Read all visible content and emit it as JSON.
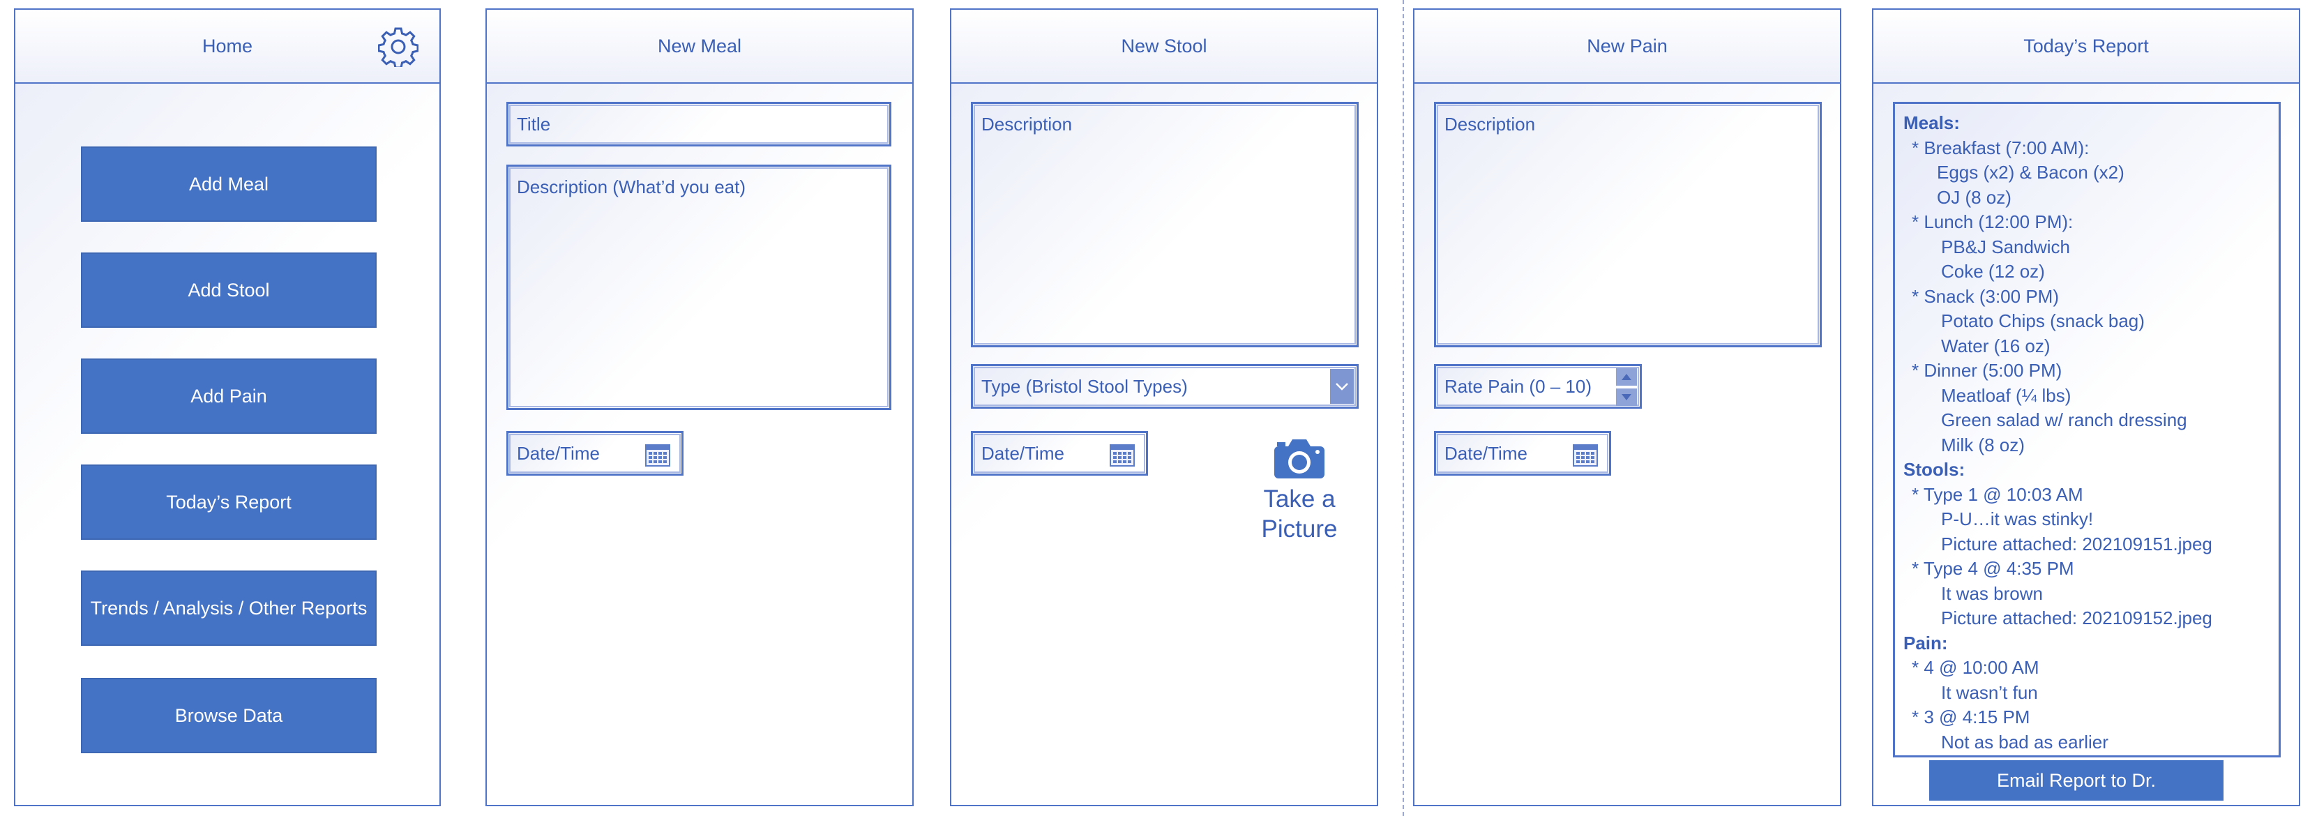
{
  "colors": {
    "accent": "#4472c4",
    "border": "#4f74c8",
    "text": "#3a5fb5"
  },
  "home": {
    "title": "Home",
    "settings_icon": "gear-icon",
    "buttons": [
      "Add Meal",
      "Add Stool",
      "Add Pain",
      "Today’s Report",
      "Trends / Analysis / Other Reports",
      "Browse Data"
    ]
  },
  "new_meal": {
    "title": "New Meal",
    "title_field": "Title",
    "description_field": "Description (What’d you eat)",
    "datetime_field": "Date/Time"
  },
  "new_stool": {
    "title": "New Stool",
    "description_field": "Description",
    "type_dropdown": "Type (Bristol Stool Types)",
    "datetime_field": "Date/Time",
    "picture_label_1": "Take a",
    "picture_label_2": "Picture"
  },
  "new_pain": {
    "title": "New Pain",
    "description_field": "Description",
    "rate_field": "Rate Pain (0 – 10)",
    "datetime_field": "Date/Time"
  },
  "report": {
    "title": "Today’s Report",
    "lines": [
      {
        "text": "Meals:",
        "style": "h"
      },
      {
        "text": "* Breakfast (7:00 AM):",
        "style": "i1"
      },
      {
        "text": "Eggs (x2) & Bacon (x2)",
        "style": "i2b"
      },
      {
        "text": "OJ (8 oz)",
        "style": "i2b"
      },
      {
        "text": "* Lunch (12:00 PM):",
        "style": "i1"
      },
      {
        "text": "PB&J Sandwich",
        "style": "i2"
      },
      {
        "text": "Coke (12 oz)",
        "style": "i2"
      },
      {
        "text": "* Snack (3:00 PM)",
        "style": "i1"
      },
      {
        "text": "Potato Chips (snack bag)",
        "style": "i2"
      },
      {
        "text": "Water (16 oz)",
        "style": "i2"
      },
      {
        "text": "* Dinner (5:00 PM)",
        "style": "i1"
      },
      {
        "text": "Meatloaf (¼ lbs)",
        "style": "i2"
      },
      {
        "text": "Green salad w/ ranch dressing",
        "style": "i2"
      },
      {
        "text": "Milk (8 oz)",
        "style": "i2"
      },
      {
        "text": "Stools:",
        "style": "h"
      },
      {
        "text": "* Type 1 @ 10:03 AM",
        "style": "i1"
      },
      {
        "text": "P-U…it was stinky!",
        "style": "i2"
      },
      {
        "text": "Picture attached: 202109151.jpeg",
        "style": "i2"
      },
      {
        "text": "* Type 4 @ 4:35 PM",
        "style": "i1"
      },
      {
        "text": "It was brown",
        "style": "i2"
      },
      {
        "text": "Picture attached: 202109152.jpeg",
        "style": "i2"
      },
      {
        "text": "Pain:",
        "style": "h"
      },
      {
        "text": "* 4 @ 10:00 AM",
        "style": "i1"
      },
      {
        "text": "It wasn’t fun",
        "style": "i2"
      },
      {
        "text": "* 3 @ 4:15 PM",
        "style": "i1"
      },
      {
        "text": "Not as bad as earlier",
        "style": "i2"
      }
    ],
    "email_button": "Email Report to Dr."
  }
}
